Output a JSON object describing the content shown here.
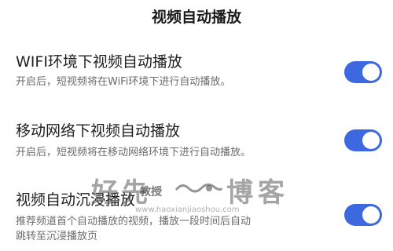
{
  "header": {
    "title": "视频自动播放"
  },
  "settings": [
    {
      "title": "WIFI环境下视频自动播放",
      "description": [
        "开启后，短视频将在WiFi环境下进行自动播放。"
      ],
      "enabled": true
    },
    {
      "title": "移动网络下视频自动播放",
      "description": [
        "开启后，短视频将在移动网络环境下进行自动播放。"
      ],
      "enabled": true
    },
    {
      "title": "视频自动沉浸播放",
      "description": [
        "推荐频道首个自动播放的视频，播放一段时间后自动",
        "跳转至沉浸播放页"
      ],
      "enabled": true
    }
  ],
  "watermark": {
    "left_text": "好先",
    "small_text": "教授",
    "right_text": "博客",
    "url_text": "www.haoxianjiaoshou.com"
  },
  "colors": {
    "toggle_on": "#3d68e0",
    "text_primary": "#1f1f1f",
    "text_secondary": "#6b6b6b"
  }
}
